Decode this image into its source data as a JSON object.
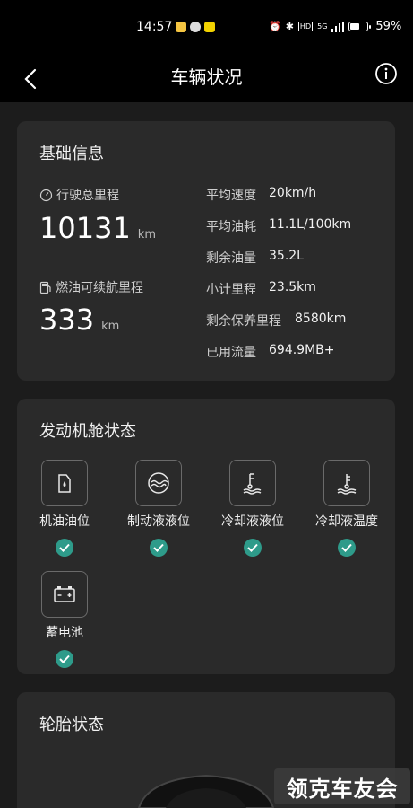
{
  "status_bar": {
    "time": "14:57",
    "battery_percent": "59%",
    "battery_level": 0.59,
    "icons": [
      "alarm-icon",
      "bluetooth-icon",
      "hd-icon",
      "5g-icon",
      "signal-icon",
      "battery-icon"
    ]
  },
  "header": {
    "title": "车辆状况",
    "back_icon": "chevron-left-icon",
    "info_icon": "info-icon"
  },
  "basic_info": {
    "title": "基础信息",
    "total_mileage": {
      "label": "行驶总里程",
      "value": "10131",
      "unit": "km",
      "icon": "odometer-icon"
    },
    "fuel_range": {
      "label": "燃油可续航里程",
      "value": "333",
      "unit": "km",
      "icon": "fuel-pump-icon"
    },
    "details": [
      {
        "key": "平均速度",
        "value": "20km/h"
      },
      {
        "key": "平均油耗",
        "value": "11.1L/100km"
      },
      {
        "key": "剩余油量",
        "value": "35.2L"
      },
      {
        "key": "小计里程",
        "value": "23.5km"
      },
      {
        "key": "剩余保养里程",
        "value": "8580km"
      },
      {
        "key": "已用流量",
        "value": "694.9MB+"
      }
    ]
  },
  "engine": {
    "title": "发动机舱状态",
    "items": [
      {
        "label": "机油油位",
        "icon": "oil-can-icon",
        "status": "ok"
      },
      {
        "label": "制动液液位",
        "icon": "brake-fluid-icon",
        "status": "ok"
      },
      {
        "label": "冷却液液位",
        "icon": "coolant-level-icon",
        "status": "ok"
      },
      {
        "label": "冷却液温度",
        "icon": "coolant-temperature-icon",
        "status": "ok"
      },
      {
        "label": "蓄电池",
        "icon": "battery-icon",
        "status": "ok"
      }
    ]
  },
  "tires": {
    "title": "轮胎状态"
  },
  "watermark": "领克车友会",
  "colors": {
    "background": "#1c1c1c",
    "card": "#2a2a2a",
    "check_ok": "#2e9b8a",
    "header": "#000000"
  }
}
